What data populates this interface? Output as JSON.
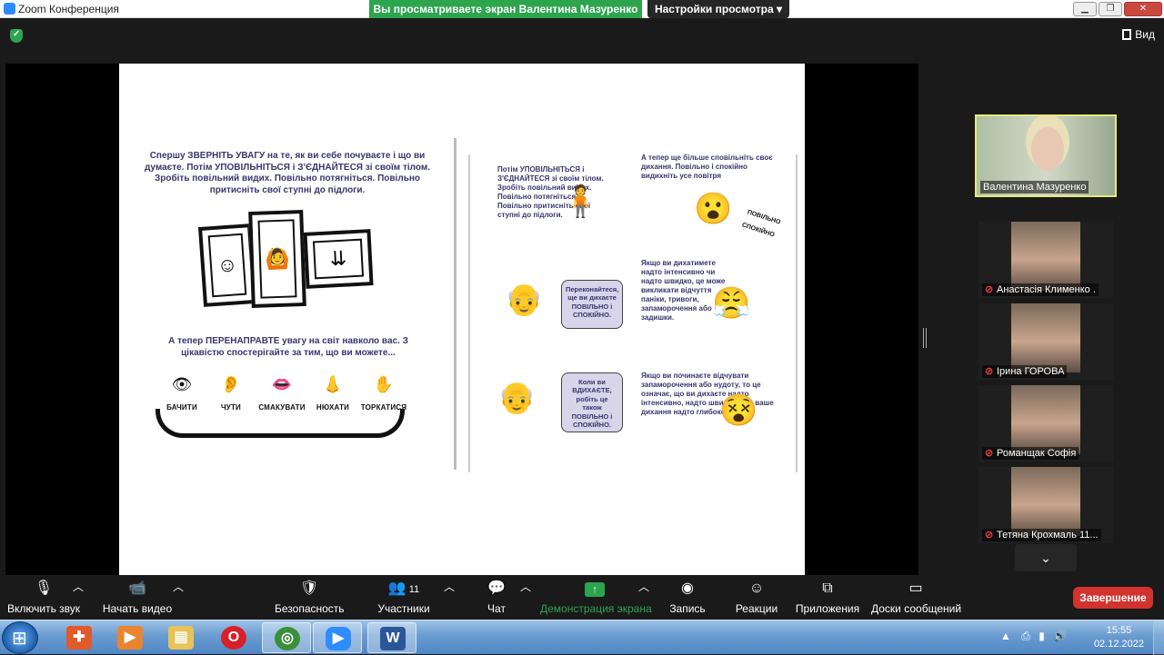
{
  "window": {
    "title": "Zoom Конференция",
    "share_banner": "Вы просматриваете экран Валентина Мазуренко",
    "view_options": "Настройки просмотра ▾",
    "view_button": "Вид"
  },
  "shared_page": {
    "left_intro": "Спершу ЗВЕРНІТЬ УВАГУ на те, як ви себе почуваєте і що ви думаєте. Потім УПОВІЛЬНІТЬСЯ і З'ЄДНАЙТЕСЯ зі своїм тілом. Зробіть повільний видих. Повільно потягніться. Повільно притисніть свої ступні до підлоги.",
    "left_redirect": "А тепер ПЕРЕНАПРАВТЕ увагу на світ навколо вас. З цікавістю спостерігайте за тим, що ви можете...",
    "senses": [
      {
        "label": "БАЧИТИ",
        "glyph": "👁"
      },
      {
        "label": "ЧУТИ",
        "glyph": "👂"
      },
      {
        "label": "СМАКУВАТИ",
        "glyph": "👄"
      },
      {
        "label": "НЮХАТИ",
        "glyph": "👃"
      },
      {
        "label": "ТОРКАТИСЯ",
        "glyph": "✋"
      }
    ],
    "right_t1": "Потім УПОВІЛЬНІТЬСЯ і З'ЄДНАЙТЕСЯ зі своїм тілом. Зробіть повільний видих. Повільно потягніться. Повільно притисніть свої ступні до підлоги.",
    "right_t2": "А тепер ще більше сповільніть своє дихання. Повільно і спокійно видихніть усе повітря",
    "tag_povilno": "ПОВІЛЬНО",
    "tag_spokiyno": "СПОКІЙНО",
    "bubble1": "Переконайтеся, ще ви дихаєте ПОВІЛЬНО і СПОКІЙНО.",
    "right_t3": "Якщо ви дихатимете надто інтенсивно чи надто швидко, це може викликати відчуття паніки, тривоги, запаморочення або задишки.",
    "bubble2": "Коли ви ВДИХАЄТЕ, робіть це також ПОВІЛЬНО і СПОКІЙНО.",
    "right_t4": "Якщо ви починаєте відчувати запаморочення або нудоту, то це означає, що ви дихаєте надто інтенсивно, надто швидко, або ваше дихання надто глибоке."
  },
  "participants": [
    {
      "name": "Валентина Мазуренко",
      "muted": false,
      "active": true
    },
    {
      "name": "Анастасія Клименко .",
      "muted": true,
      "active": false
    },
    {
      "name": "Ірина ГОРОВА",
      "muted": true,
      "active": false
    },
    {
      "name": "Романщак Софія",
      "muted": true,
      "active": false
    },
    {
      "name": "Тетяна Крохмаль 11...",
      "muted": true,
      "active": false
    }
  ],
  "toolbar": {
    "unmute": "Включить звук",
    "start_video": "Начать видео",
    "security": "Безопасность",
    "participants": "Участники",
    "participants_count": "11",
    "chat": "Чат",
    "share": "Демонстрация экрана",
    "record": "Запись",
    "reactions": "Реакции",
    "apps": "Приложения",
    "whiteboards": "Доски сообщений",
    "end": "Завершение"
  },
  "taskbar": {
    "time": "15:55",
    "date": "02.12.2022"
  },
  "colors": {
    "share_green": "#2da44e",
    "end_red": "#d2332e",
    "comic_text": "#38366e",
    "bubble_fill": "#d8d4ea"
  }
}
